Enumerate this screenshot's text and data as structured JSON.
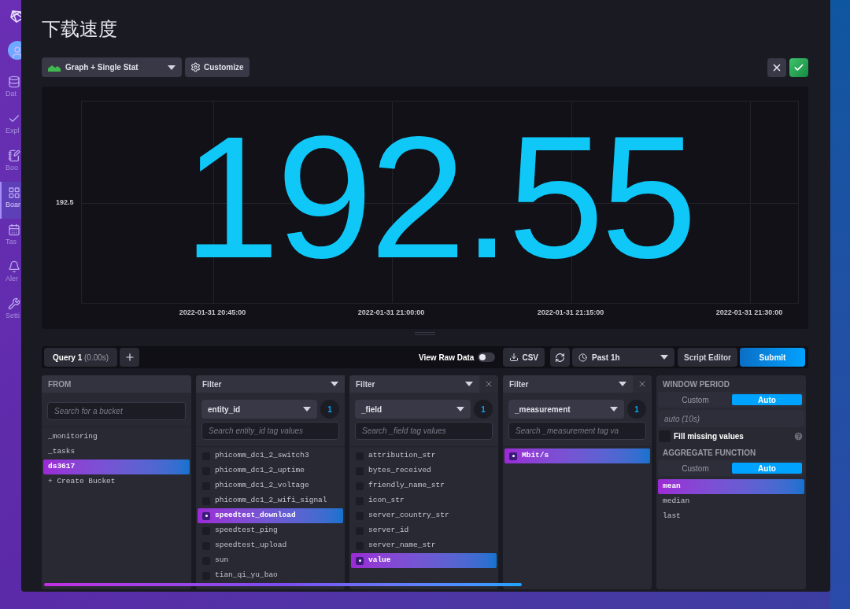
{
  "sidebar": {
    "items": [
      {
        "label": "Dat",
        "selected": false
      },
      {
        "label": "Expl",
        "selected": false
      },
      {
        "label": "Boo",
        "selected": false
      },
      {
        "label": "Boar",
        "selected": true
      },
      {
        "label": "Tas",
        "selected": false
      },
      {
        "label": "Aler",
        "selected": false
      },
      {
        "label": "Setti",
        "selected": false
      }
    ]
  },
  "dialog": {
    "title": "下载速度",
    "visualization": "Graph + Single Stat",
    "customize": "Customize",
    "chart": {
      "stat": "192.55",
      "y_ticks": [
        "192.5"
      ],
      "x_ticks": [
        "2022-01-31 20:45:00",
        "2022-01-31 21:00:00",
        "2022-01-31 21:15:00",
        "2022-01-31 21:30:00"
      ]
    },
    "query_bar": {
      "tabs": [
        {
          "label": "Query 1",
          "timing": "(0.00s)",
          "selected": true
        }
      ],
      "view_raw": {
        "label": "View Raw Data",
        "on": false
      },
      "csv": "CSV",
      "time_range": "Past 1h",
      "script_editor": "Script Editor",
      "submit": "Submit"
    },
    "from": {
      "title": "FROM",
      "placeholder": "Search for a bucket",
      "buckets": [
        {
          "name": "_monitoring",
          "selected": false
        },
        {
          "name": "_tasks",
          "selected": false
        },
        {
          "name": "ds3617",
          "selected": true
        }
      ],
      "create": "+ Create Bucket"
    },
    "filters": [
      {
        "title": "Filter",
        "closable": false,
        "key": "entity_id",
        "count": "1",
        "placeholder": "Search entity_id tag values",
        "values": [
          {
            "name": "phicomm_dc1_2_switch3",
            "selected": false
          },
          {
            "name": "phicomm_dc1_2_uptime",
            "selected": false
          },
          {
            "name": "phicomm_dc1_2_voltage",
            "selected": false
          },
          {
            "name": "phicomm_dc1_2_wifi_signal",
            "selected": false
          },
          {
            "name": "speedtest_download",
            "selected": true
          },
          {
            "name": "speedtest_ping",
            "selected": false
          },
          {
            "name": "speedtest_upload",
            "selected": false
          },
          {
            "name": "sun",
            "selected": false
          },
          {
            "name": "tian_qi_yu_bao",
            "selected": false
          }
        ]
      },
      {
        "title": "Filter",
        "closable": true,
        "key": "_field",
        "count": "1",
        "placeholder": "Search _field tag values",
        "values": [
          {
            "name": "attribution_str",
            "selected": false
          },
          {
            "name": "bytes_received",
            "selected": false
          },
          {
            "name": "friendly_name_str",
            "selected": false
          },
          {
            "name": "icon_str",
            "selected": false
          },
          {
            "name": "server_country_str",
            "selected": false
          },
          {
            "name": "server_id",
            "selected": false
          },
          {
            "name": "server_name_str",
            "selected": false
          },
          {
            "name": "value",
            "selected": true
          }
        ]
      },
      {
        "title": "Filter",
        "closable": true,
        "key": "_measurement",
        "count": "1",
        "placeholder": "Search _measurement tag va",
        "values": [
          {
            "name": "Mbit/s",
            "selected": true
          }
        ]
      }
    ],
    "aggregate": {
      "window_title": "WINDOW PERIOD",
      "window_modes": [
        {
          "label": "Custom",
          "selected": false
        },
        {
          "label": "Auto",
          "selected": true
        }
      ],
      "window_placeholder": "auto (10s)",
      "fill_missing": {
        "label": "Fill missing values",
        "checked": false
      },
      "function_title": "AGGREGATE FUNCTION",
      "function_modes": [
        {
          "label": "Custom",
          "selected": false
        },
        {
          "label": "Auto",
          "selected": true
        }
      ],
      "functions": [
        {
          "name": "mean",
          "selected": true
        },
        {
          "name": "median",
          "selected": false
        },
        {
          "name": "last",
          "selected": false
        }
      ]
    }
  }
}
